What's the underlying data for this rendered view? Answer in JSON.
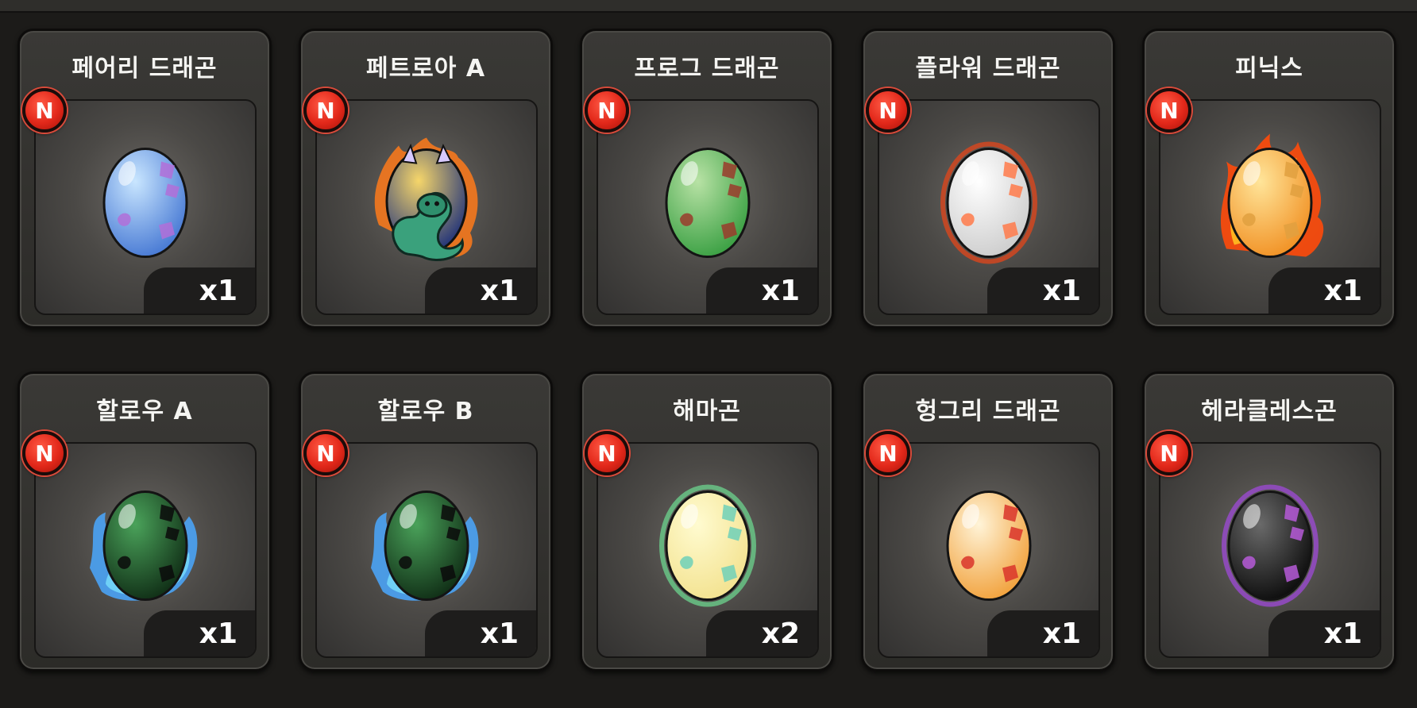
{
  "badge_letter": "N",
  "items": [
    {
      "name": "페어리 드래곤",
      "count": "x1",
      "icon": "blue-purple-egg-icon",
      "colors": {
        "top": "#c9e6ff",
        "bottom": "#3b6fd0",
        "spot": "#b16ed8",
        "glow": "none"
      }
    },
    {
      "name": "페트로아 A",
      "count": "x1",
      "icon": "serpent-dragon-icon",
      "colors": {
        "top": "#f6d66a",
        "bottom": "#1c2f7a",
        "spot": "#3aa17c",
        "glow": "#ff7a1a"
      }
    },
    {
      "name": "프로그 드래곤",
      "count": "x1",
      "icon": "green-egg-icon",
      "colors": {
        "top": "#b8e2a5",
        "bottom": "#2f9a3a",
        "spot": "#9a3b2c",
        "glow": "none"
      }
    },
    {
      "name": "플라워 드래곤",
      "count": "x1",
      "icon": "white-egg-icon",
      "colors": {
        "top": "#ffffff",
        "bottom": "#c9c9c9",
        "spot": "#ff7a4a",
        "glow": "#d9461d"
      }
    },
    {
      "name": "피닉스",
      "count": "x1",
      "icon": "flaming-egg-icon",
      "colors": {
        "top": "#ffe59a",
        "bottom": "#f08a1a",
        "spot": "#e0a040",
        "glow": "#ff4a0a"
      }
    },
    {
      "name": "할로우 A",
      "count": "x1",
      "icon": "shadow-flame-egg-icon",
      "colors": {
        "top": "#4aa25a",
        "bottom": "#0b2410",
        "spot": "#0a0a0a",
        "glow": "#4aa8ff"
      }
    },
    {
      "name": "할로우 B",
      "count": "x1",
      "icon": "shadow-flame-egg-icon",
      "colors": {
        "top": "#4aa25a",
        "bottom": "#0b2410",
        "spot": "#0a0a0a",
        "glow": "#4aa8ff"
      }
    },
    {
      "name": "해마곤",
      "count": "x2",
      "icon": "yellow-egg-icon",
      "colors": {
        "top": "#fffbd0",
        "bottom": "#f2e08a",
        "spot": "#6fd0b8",
        "glow": "#6acc8a"
      }
    },
    {
      "name": "헝그리 드래곤",
      "count": "x1",
      "icon": "orange-egg-icon",
      "colors": {
        "top": "#fff4d8",
        "bottom": "#f09a2e",
        "spot": "#d9342a",
        "glow": "none"
      }
    },
    {
      "name": "헤라클레스곤",
      "count": "x1",
      "icon": "black-egg-icon",
      "colors": {
        "top": "#6a6a6a",
        "bottom": "#050505",
        "spot": "#b65ad8",
        "glow": "#9a4ad0"
      }
    }
  ]
}
